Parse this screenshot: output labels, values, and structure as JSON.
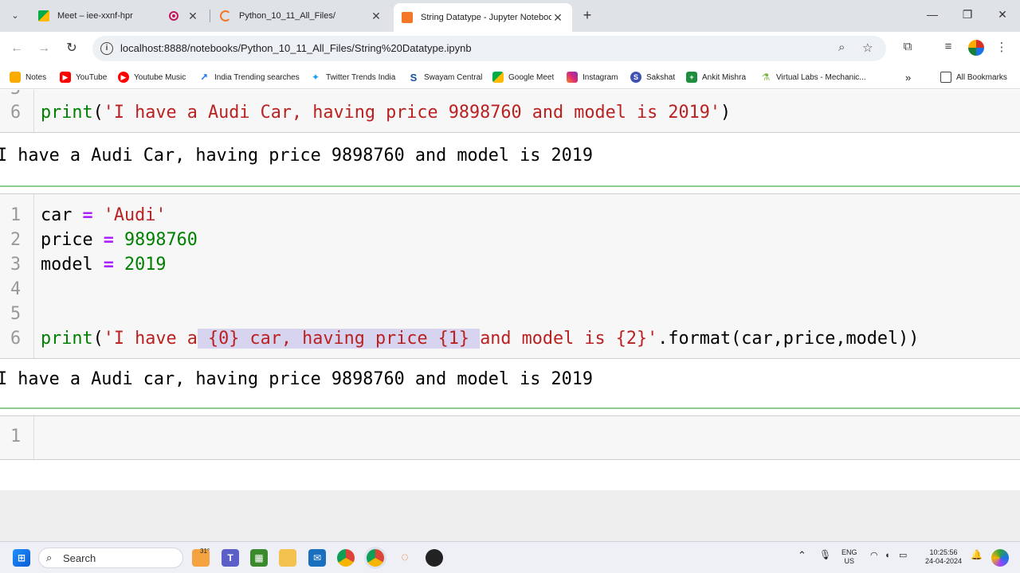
{
  "browser": {
    "tabs": [
      {
        "title": "Meet – iee-xxnf-hpr",
        "icon": "google-meet-icon"
      },
      {
        "title": "Python_10_11_All_Files/",
        "icon": "jupyter-loading-icon"
      },
      {
        "title": "String Datatype - Jupyter Notebook",
        "icon": "jupyter-notebook-icon"
      }
    ],
    "url": "localhost:8888/notebooks/Python_10_11_All_Files/String%20Datatype.ipynb",
    "bookmarks": [
      "Notes",
      "YouTube",
      "Youtube Music",
      "India Trending searches",
      "Twitter Trends India",
      "Swayam Central",
      "Google Meet",
      "Instagram",
      "Sakshat",
      "Ankit Mishra",
      "Virtual Labs - Mechanic..."
    ],
    "all_bookmarks": "All Bookmarks"
  },
  "notebook": {
    "cell1": {
      "partial_line_number": "5",
      "line_number": "6",
      "code": {
        "fn": "print",
        "open": "(",
        "string": "'I have a Audi Car, having price 9898760 and model is 2019'",
        "close": ")"
      },
      "output": "I have a Audi Car, having price 9898760 and model is 2019"
    },
    "cell2": {
      "line_numbers": [
        "1",
        "2",
        "3",
        "4",
        "5",
        "6"
      ],
      "line1": {
        "name": "car",
        "op": "=",
        "value": "'Audi'"
      },
      "line2": {
        "name": "price",
        "op": "=",
        "value": "9898760"
      },
      "line3": {
        "name": "model",
        "op": "=",
        "value": "2019"
      },
      "line6": {
        "fn": "print",
        "open": "(",
        "str_pre": "'I have a",
        "str_sel": " {0} car, having price {1} ",
        "str_post": "and model is {2}'",
        "rest": ".format(car,price,model))"
      },
      "output": "I have a Audi car, having price 9898760 and model is 2019"
    },
    "cell3": {
      "line_number": "1"
    }
  },
  "taskbar": {
    "search_label": "Search",
    "weather": "31°",
    "lang_top": "ENG",
    "lang_bottom": "US",
    "time": "10:25:56",
    "date": "24-04-2024"
  },
  "colors": {
    "keyword": "#008000",
    "string": "#ba2121",
    "operator": "#aa22ff",
    "selection": "#d7d4f0"
  }
}
